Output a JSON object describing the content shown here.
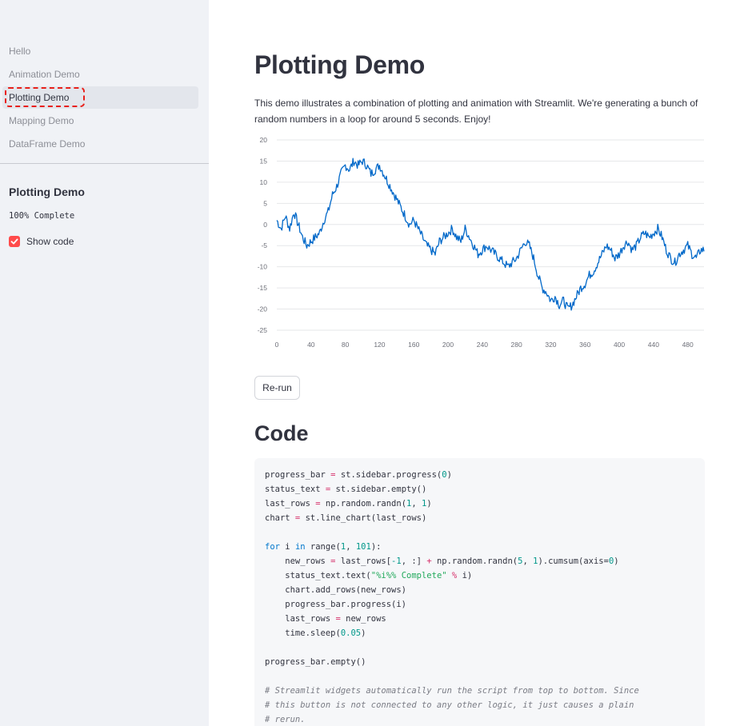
{
  "sidebar": {
    "nav": [
      {
        "label": "Hello",
        "active": false
      },
      {
        "label": "Animation Demo",
        "active": false
      },
      {
        "label": "Plotting Demo",
        "active": true
      },
      {
        "label": "Mapping Demo",
        "active": false
      },
      {
        "label": "DataFrame Demo",
        "active": false
      }
    ],
    "title": "Plotting Demo",
    "status": "100% Complete",
    "progress": 1.0,
    "show_code": {
      "label": "Show code",
      "checked": true
    },
    "accent": "#ff4b4b"
  },
  "main": {
    "title": "Plotting Demo",
    "description": "This demo illustrates a combination of plotting and animation with Streamlit. We're generating a bunch of random numbers in a loop for around 5 seconds. Enjoy!",
    "rerun_label": "Re-run",
    "code_title": "Code",
    "code_lines": [
      "progress_bar = st.sidebar.progress(0)",
      "status_text = st.sidebar.empty()",
      "last_rows = np.random.randn(1, 1)",
      "chart = st.line_chart(last_rows)",
      "",
      "for i in range(1, 101):",
      "    new_rows = last_rows[-1, :] + np.random.randn(5, 1).cumsum(axis=0)",
      "    status_text.text(\"%i%% Complete\" % i)",
      "    chart.add_rows(new_rows)",
      "    progress_bar.progress(i)",
      "    last_rows = new_rows",
      "    time.sleep(0.05)",
      "",
      "progress_bar.empty()",
      "",
      "# Streamlit widgets automatically run the script from top to bottom. Since",
      "# this button is not connected to any other logic, it just causes a plain",
      "# rerun."
    ]
  },
  "chart_data": {
    "type": "line",
    "line_color": "#0068c9",
    "xlim": [
      0,
      499
    ],
    "ylim": [
      -25,
      20
    ],
    "xticks": [
      0,
      40,
      80,
      120,
      160,
      200,
      240,
      280,
      320,
      360,
      400,
      440,
      480
    ],
    "yticks": [
      20,
      15,
      10,
      5,
      0,
      -5,
      -10,
      -15,
      -20,
      -25
    ],
    "grid": true,
    "series": [
      {
        "points": [
          [
            0,
            1
          ],
          [
            5,
            -1
          ],
          [
            10,
            2
          ],
          [
            15,
            -1
          ],
          [
            20,
            3
          ],
          [
            25,
            0
          ],
          [
            30,
            -3
          ],
          [
            35,
            -5
          ],
          [
            40,
            -4
          ],
          [
            45,
            -3
          ],
          [
            50,
            -2
          ],
          [
            55,
            1
          ],
          [
            60,
            3
          ],
          [
            65,
            7
          ],
          [
            70,
            9
          ],
          [
            75,
            12
          ],
          [
            80,
            14
          ],
          [
            85,
            13
          ],
          [
            90,
            15
          ],
          [
            95,
            14
          ],
          [
            100,
            15
          ],
          [
            105,
            14
          ],
          [
            110,
            12
          ],
          [
            115,
            13
          ],
          [
            120,
            14
          ],
          [
            125,
            12
          ],
          [
            130,
            10
          ],
          [
            135,
            8
          ],
          [
            140,
            6
          ],
          [
            145,
            4
          ],
          [
            150,
            2
          ],
          [
            155,
            0
          ],
          [
            160,
            1
          ],
          [
            165,
            -1
          ],
          [
            170,
            -3
          ],
          [
            175,
            -5
          ],
          [
            180,
            -6
          ],
          [
            185,
            -7
          ],
          [
            190,
            -4
          ],
          [
            195,
            -3
          ],
          [
            200,
            -2
          ],
          [
            205,
            -1
          ],
          [
            210,
            -3
          ],
          [
            215,
            -4
          ],
          [
            220,
            -1
          ],
          [
            225,
            -3
          ],
          [
            230,
            -5
          ],
          [
            235,
            -7
          ],
          [
            240,
            -6
          ],
          [
            245,
            -5
          ],
          [
            250,
            -6
          ],
          [
            255,
            -7
          ],
          [
            260,
            -8
          ],
          [
            265,
            -9
          ],
          [
            270,
            -10
          ],
          [
            275,
            -9
          ],
          [
            280,
            -8
          ],
          [
            285,
            -6
          ],
          [
            290,
            -4
          ],
          [
            295,
            -5
          ],
          [
            300,
            -8
          ],
          [
            305,
            -12
          ],
          [
            310,
            -15
          ],
          [
            315,
            -16
          ],
          [
            320,
            -18
          ],
          [
            325,
            -17
          ],
          [
            330,
            -19
          ],
          [
            335,
            -18
          ],
          [
            340,
            -20
          ],
          [
            345,
            -19
          ],
          [
            350,
            -17
          ],
          [
            355,
            -15
          ],
          [
            360,
            -14
          ],
          [
            365,
            -12
          ],
          [
            370,
            -11
          ],
          [
            375,
            -9
          ],
          [
            380,
            -7
          ],
          [
            385,
            -5
          ],
          [
            390,
            -6
          ],
          [
            395,
            -8
          ],
          [
            400,
            -7
          ],
          [
            405,
            -5
          ],
          [
            410,
            -4
          ],
          [
            415,
            -6
          ],
          [
            420,
            -5
          ],
          [
            425,
            -3
          ],
          [
            430,
            -2
          ],
          [
            435,
            -3
          ],
          [
            440,
            -2
          ],
          [
            445,
            -1
          ],
          [
            450,
            -3
          ],
          [
            455,
            -6
          ],
          [
            460,
            -8
          ],
          [
            465,
            -9
          ],
          [
            470,
            -7
          ],
          [
            475,
            -6
          ],
          [
            480,
            -5
          ],
          [
            485,
            -7
          ],
          [
            490,
            -8
          ],
          [
            495,
            -6
          ]
        ]
      }
    ]
  }
}
